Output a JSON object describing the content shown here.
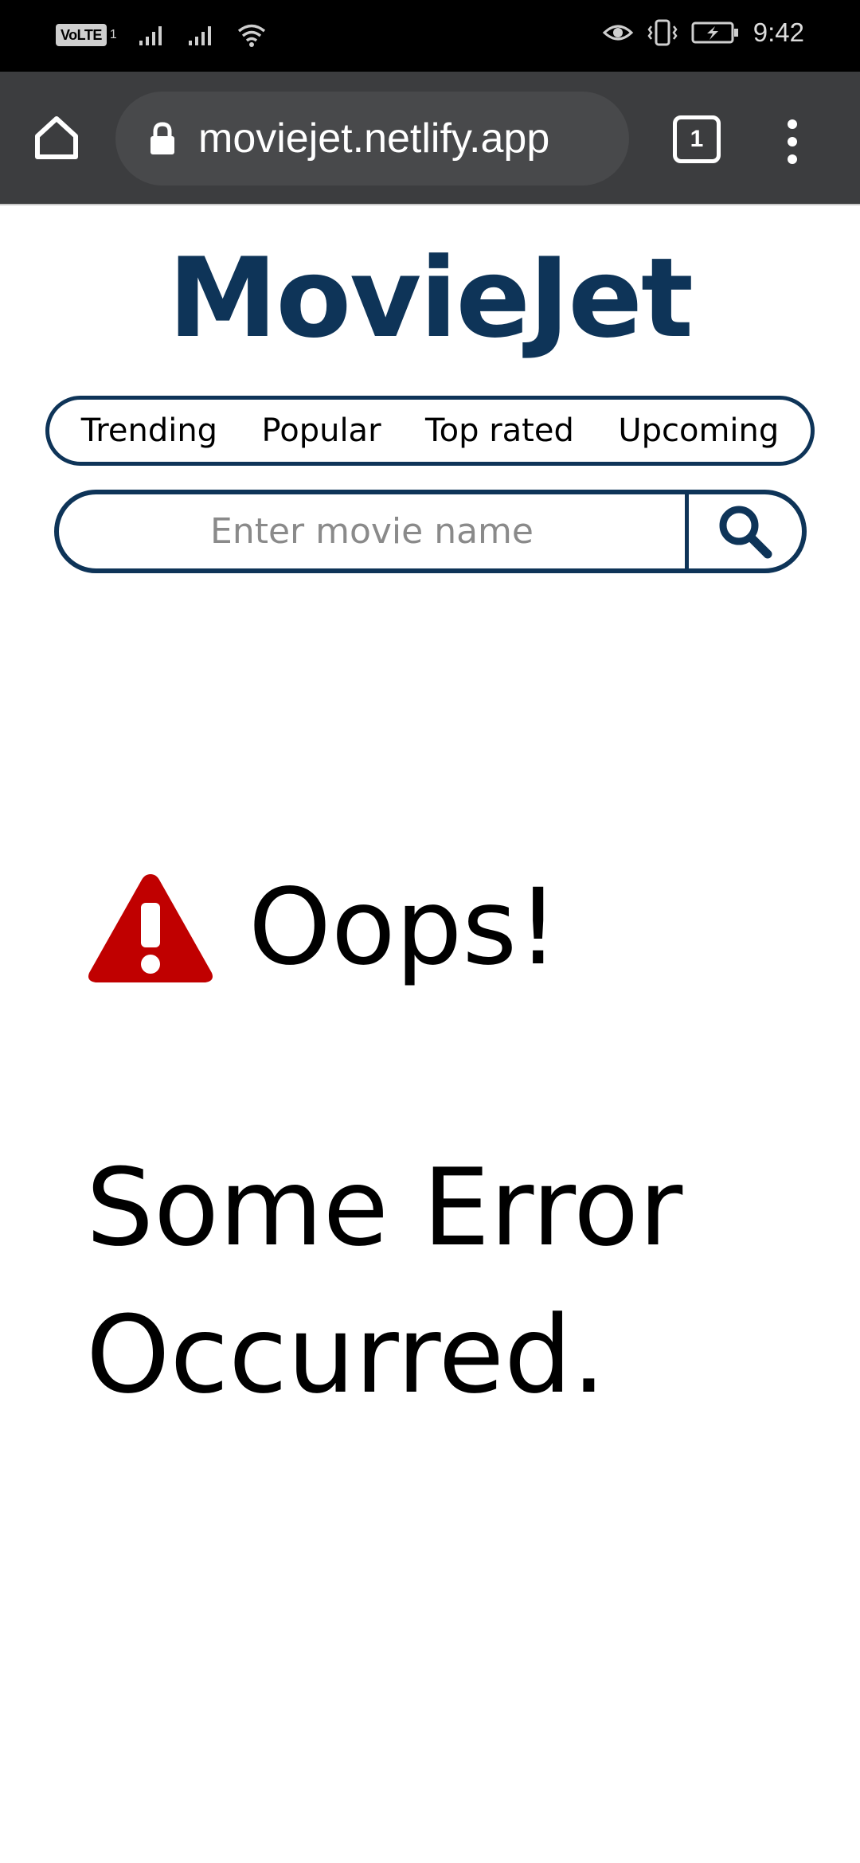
{
  "status_bar": {
    "volte_label": "VoLTE",
    "volte_sub": "1",
    "time": "9:42",
    "icons": [
      "signal-icon",
      "signal-icon",
      "wifi-icon",
      "eye-icon",
      "vibrate-icon",
      "battery-charging-icon"
    ]
  },
  "browser": {
    "url": "moviejet.netlify.app",
    "tab_count": "1",
    "icons": [
      "home-icon",
      "lock-icon",
      "tabs-icon",
      "more-vert-icon"
    ]
  },
  "page": {
    "logo": "MovieJet",
    "nav": [
      "Trending",
      "Popular",
      "Top rated",
      "Upcoming"
    ],
    "search": {
      "placeholder": "Enter movie name",
      "value": "",
      "icon": "search-icon"
    },
    "error": {
      "heading": "Oops!",
      "message": "Some Error Occurred.",
      "icon": "warning-icon"
    }
  },
  "colors": {
    "brand": "#0e3458",
    "warning": "#c00000",
    "status_bar_bg": "#000000",
    "browser_bar_bg": "#3c3d3f"
  }
}
